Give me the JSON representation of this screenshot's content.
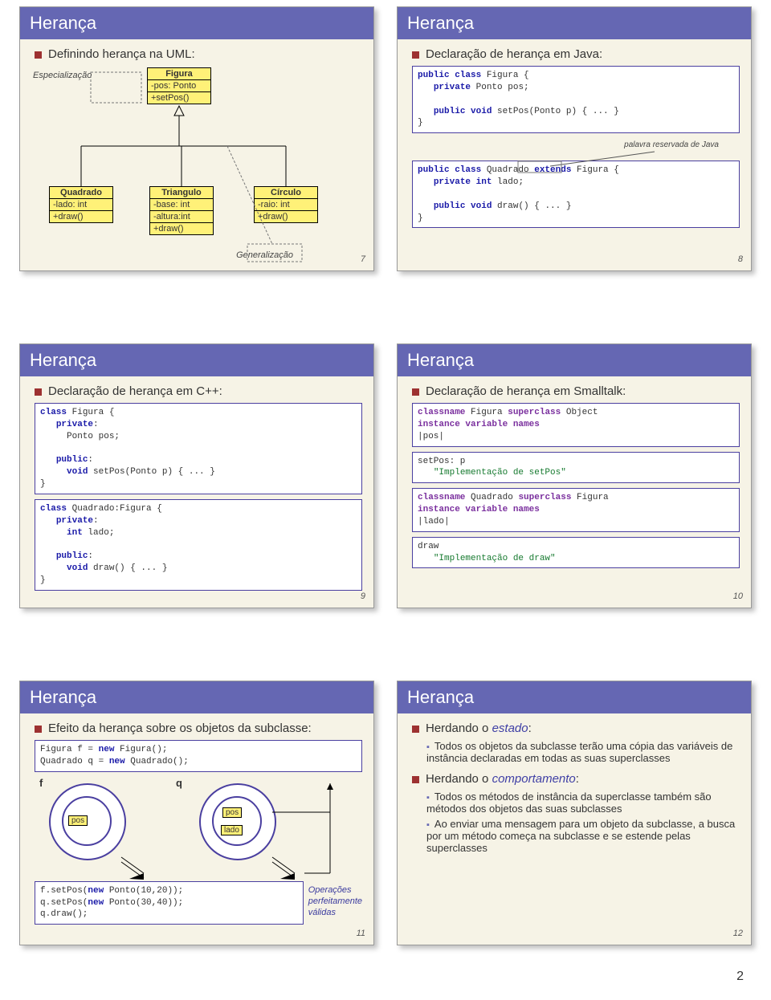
{
  "title": "Herança",
  "footer_page": "2",
  "s7": {
    "num": "7",
    "bullet": "Definindo herança na UML:",
    "noteL": "Especialização",
    "noteR": "Generalização",
    "figura": {
      "name": "Figura",
      "attr": "-pos: Ponto",
      "op": "+setPos()"
    },
    "quadrado": {
      "name": "Quadrado",
      "attr": "-lado: int",
      "op": "+draw()"
    },
    "triangulo": {
      "name": "Triangulo",
      "a1": "-base: int",
      "a2": "-altura:int",
      "op": "+draw()"
    },
    "circulo": {
      "name": "Círculo",
      "attr": "-raio: int",
      "op": "+draw()"
    }
  },
  "s8": {
    "num": "8",
    "bullet": "Declaração de herança em Java:",
    "note": "palavra reservada de Java",
    "code1": "public class Figura {\n   private Ponto pos;\n\n   public void setPos(Ponto p) { ... }\n}",
    "code2": "public class Quadrado extends Figura {\n   private int lado;\n\n   public void draw() { ... }\n}"
  },
  "s9": {
    "num": "9",
    "bullet": "Declaração de herança em C++:",
    "code1": "class Figura {\n   private:\n     Ponto pos;\n\n   public:\n     void setPos(Ponto p) { ... }\n}",
    "code2": "class Quadrado:Figura {\n   private:\n     int lado;\n\n   public:\n     void draw() { ... }\n}"
  },
  "s10": {
    "num": "10",
    "bullet": "Declaração de herança em Smalltalk:",
    "c1": "classname Figura superclass Object\ninstance variable names\n|pos|",
    "c2": "setPos: p\n   \"Implementação de setPos\"",
    "c3": "classname Quadrado superclass Figura\ninstance variable names\n|lado|",
    "c4": "draw\n   \"Implementação de draw\""
  },
  "s11": {
    "num": "11",
    "bullet": "Efeito da herança sobre os objetos da subclasse:",
    "code1": "Figura f = new Figura();\nQuadrado q = new Quadrado();",
    "note": "Operações\nperfeitamente\nválidas",
    "code2": "f.setPos(new Ponto(10,20));\nq.setPos(new Ponto(30,40));\nq.draw();",
    "f": "f",
    "q": "q",
    "pos": "pos",
    "lado": "lado"
  },
  "s12": {
    "num": "12",
    "b1": "Herdando o ",
    "b1e": "estado",
    "b1s": ":",
    "sub1": "Todos os objetos da subclasse terão uma cópia das variáveis de instância declaradas em todas as suas superclasses",
    "b2": "Herdando o ",
    "b2e": "comportamento",
    "b2s": ":",
    "sub2a": "Todos os métodos de instância da superclasse também são métodos dos objetos das suas subclasses",
    "sub2b": "Ao enviar uma mensagem para um objeto da subclasse, a busca por um método começa na subclasse e se estende pelas superclasses"
  }
}
